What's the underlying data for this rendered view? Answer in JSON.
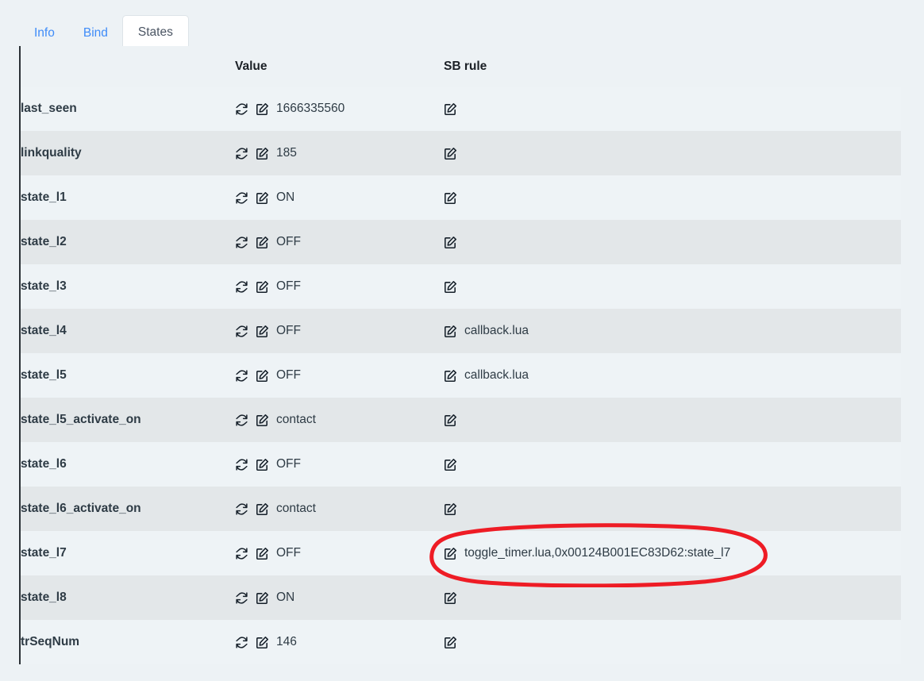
{
  "tabs": [
    {
      "label": "Info",
      "active": false
    },
    {
      "label": "Bind",
      "active": false
    },
    {
      "label": "States",
      "active": true
    }
  ],
  "table": {
    "headers": {
      "key": "",
      "value": "Value",
      "rule": "SB rule"
    },
    "icons": {
      "refresh": "refresh-icon",
      "edit": "edit-icon"
    },
    "rows": [
      {
        "key": "last_seen",
        "value": "1666335560",
        "rule": ""
      },
      {
        "key": "linkquality",
        "value": "185",
        "rule": ""
      },
      {
        "key": "state_l1",
        "value": "ON",
        "rule": ""
      },
      {
        "key": "state_l2",
        "value": "OFF",
        "rule": ""
      },
      {
        "key": "state_l3",
        "value": "OFF",
        "rule": ""
      },
      {
        "key": "state_l4",
        "value": "OFF",
        "rule": "callback.lua"
      },
      {
        "key": "state_l5",
        "value": "OFF",
        "rule": "callback.lua"
      },
      {
        "key": "state_l5_activate_on",
        "value": "contact",
        "rule": ""
      },
      {
        "key": "state_l6",
        "value": "OFF",
        "rule": ""
      },
      {
        "key": "state_l6_activate_on",
        "value": "contact",
        "rule": ""
      },
      {
        "key": "state_l7",
        "value": "OFF",
        "rule": "toggle_timer.lua,0x00124B001EC83D62:state_l7"
      },
      {
        "key": "state_l8",
        "value": "ON",
        "rule": ""
      },
      {
        "key": "trSeqNum",
        "value": "146",
        "rule": ""
      }
    ]
  },
  "annotation": {
    "name": "red-ellipse-highlight",
    "color": "#ee1c25",
    "target_row": "state_l7"
  },
  "colors": {
    "page_background": "#edf2f5",
    "row_odd": "#eef3f6",
    "row_even": "#e3e7e9",
    "tab_link": "#3f8cf8",
    "tab_active_text": "#4b5563",
    "text": "#2e3b45",
    "key_text": "#1b2026",
    "table_left_border": "#2b3136"
  }
}
